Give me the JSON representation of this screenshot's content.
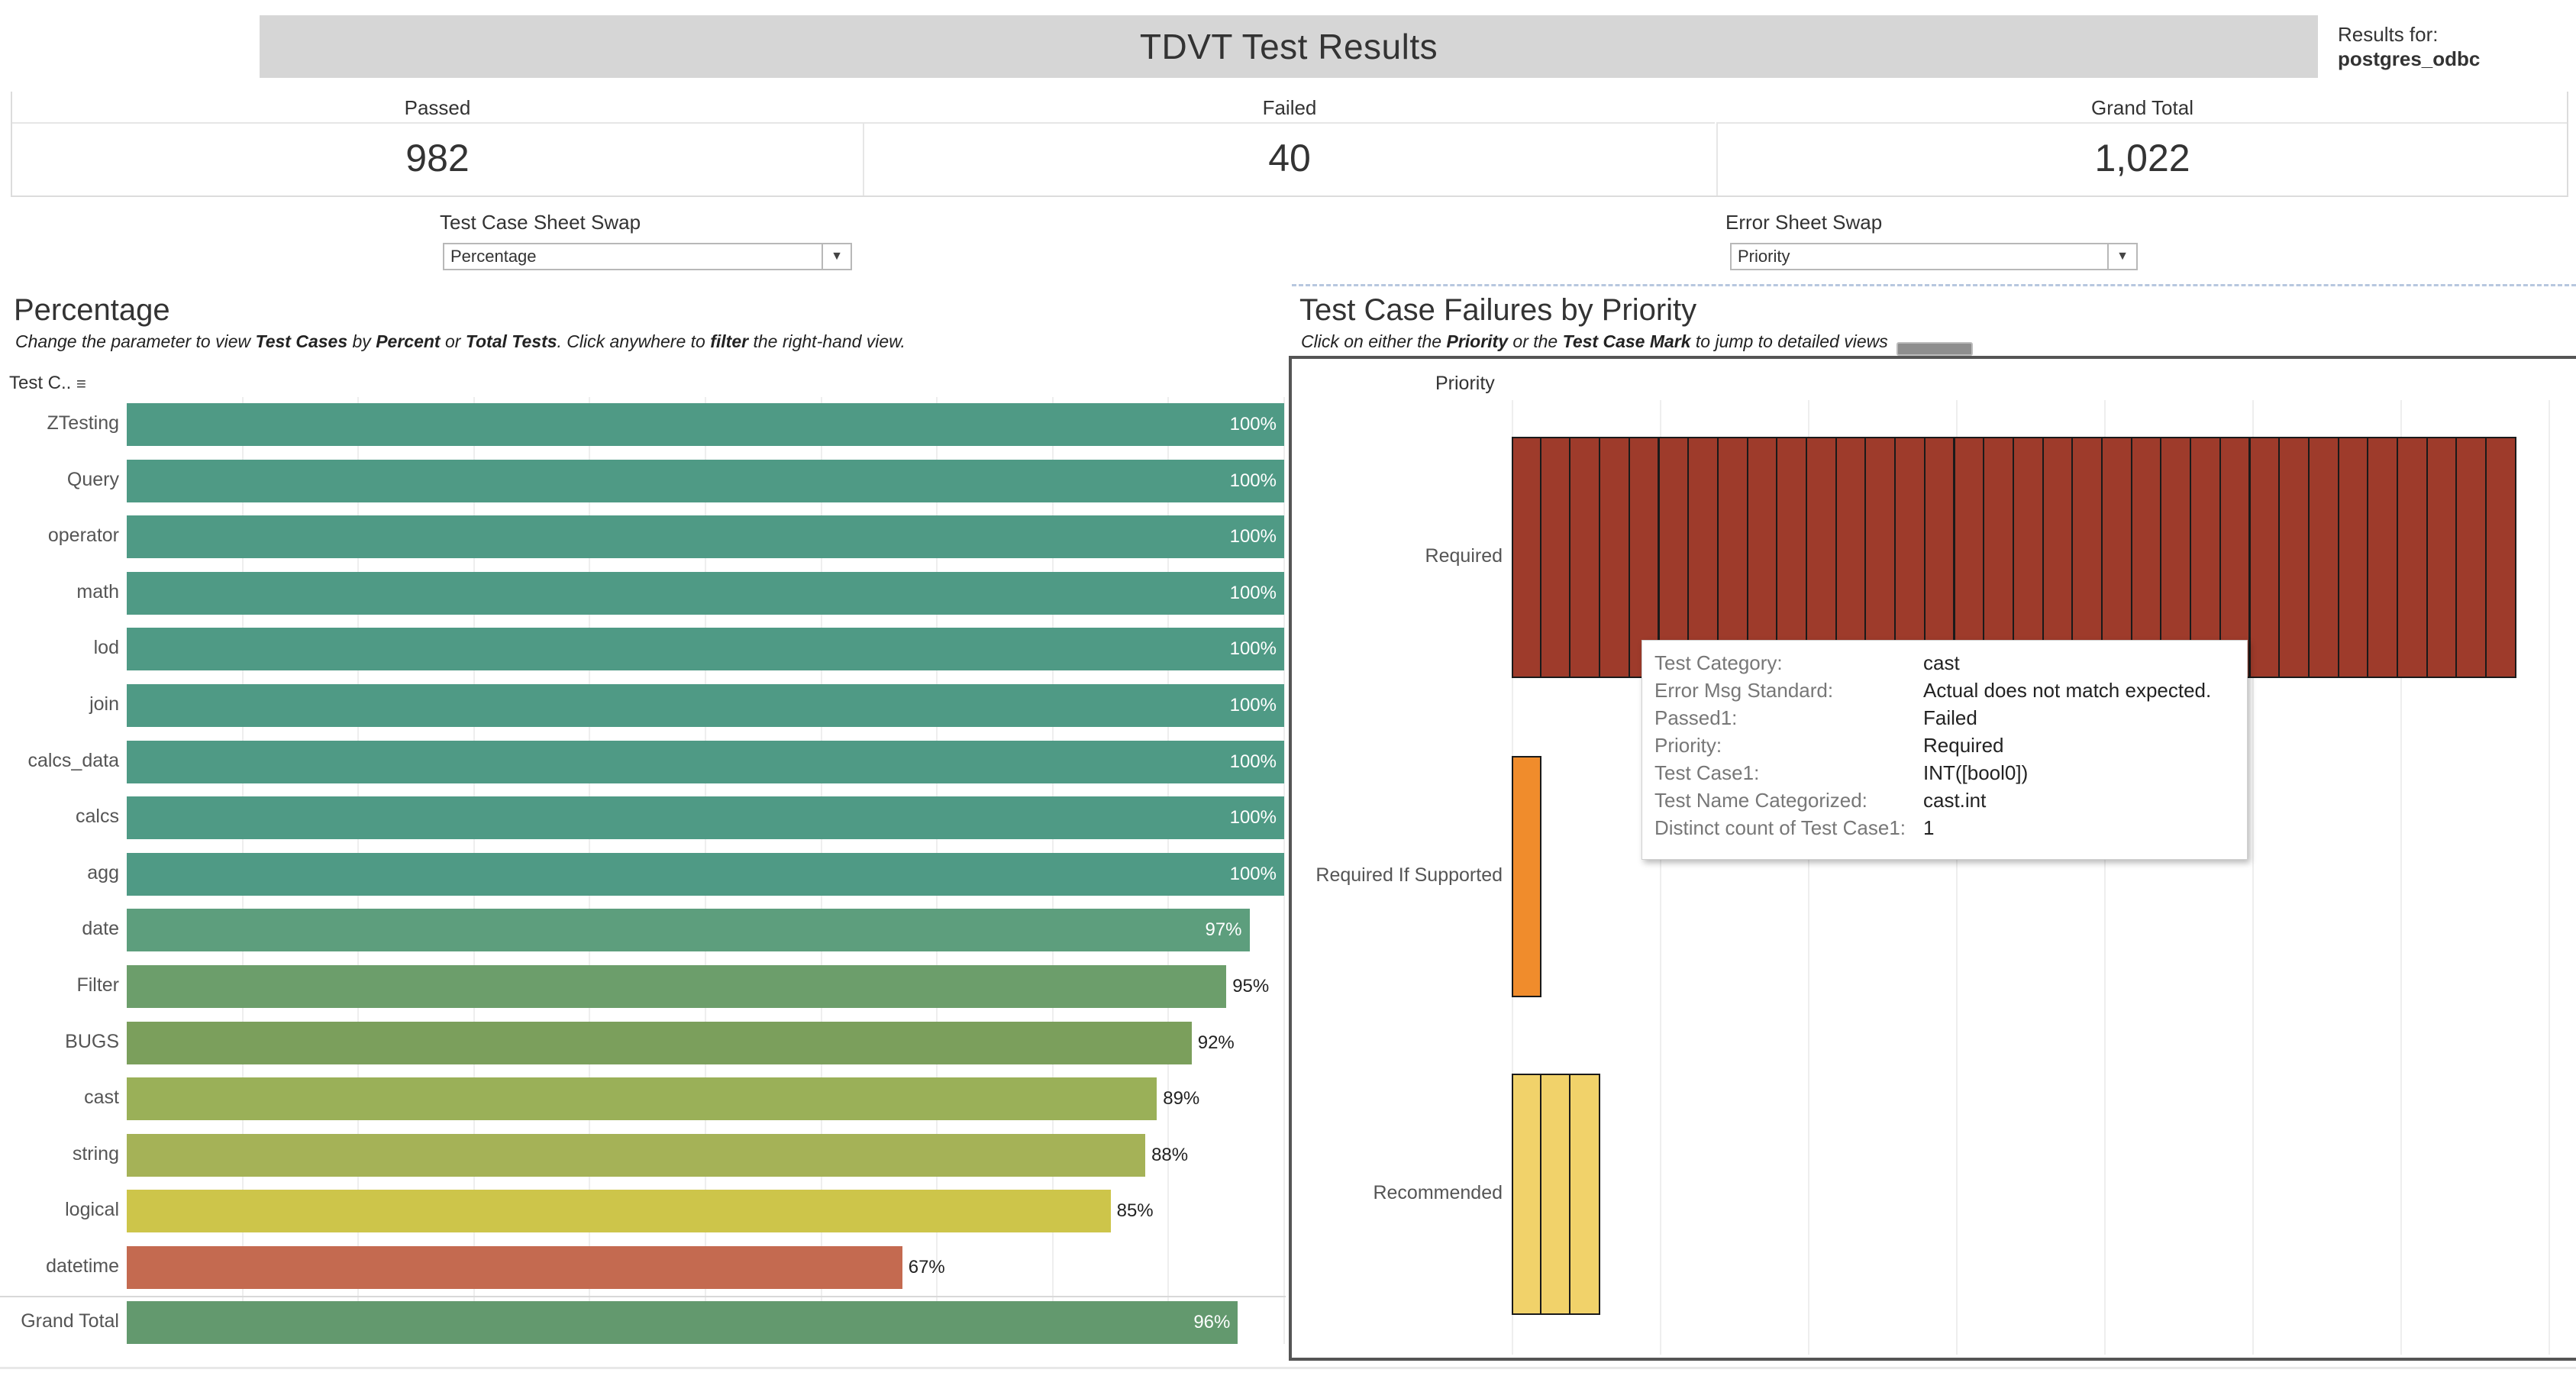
{
  "header": {
    "title": "TDVT Test Results",
    "results_for_label": "Results for:",
    "results_for_value": "postgres_odbc"
  },
  "summary": {
    "passed_label": "Passed",
    "passed_value": "982",
    "failed_label": "Failed",
    "failed_value": "40",
    "total_label": "Grand Total",
    "total_value": "1,022"
  },
  "params": {
    "test_case_label": "Test Case Sheet Swap",
    "test_case_value": "Percentage",
    "error_label": "Error Sheet Swap",
    "error_value": "Priority"
  },
  "left": {
    "title": "Percentage",
    "subtitle_html": "Change the parameter to view <b>Test Cases</b> by <b>Percent</b> or <b>Total Tests</b>. Click anywhere to <b>filter</b> the right-hand view.",
    "axis_header": "Test C..",
    "sort_icon": "sort-descending-icon"
  },
  "chart_data": [
    {
      "type": "bar",
      "orientation": "horizontal",
      "categories": [
        "ZTesting",
        "Query",
        "operator",
        "math",
        "lod",
        "join",
        "calcs_data",
        "calcs",
        "agg",
        "date",
        "Filter",
        "BUGS",
        "cast",
        "string",
        "logical",
        "datetime",
        "Grand Total"
      ],
      "values": [
        100,
        100,
        100,
        100,
        100,
        100,
        100,
        100,
        100,
        97,
        95,
        92,
        89,
        88,
        85,
        67,
        96
      ],
      "labels": [
        "100%",
        "100%",
        "100%",
        "100%",
        "100%",
        "100%",
        "100%",
        "100%",
        "100%",
        "97%",
        "95%",
        "92%",
        "89%",
        "88%",
        "85%",
        "67%",
        "96%"
      ],
      "colors": [
        "#4f9a85",
        "#4f9a85",
        "#4f9a85",
        "#4f9a85",
        "#4f9a85",
        "#4f9a85",
        "#4f9a85",
        "#4f9a85",
        "#4f9a85",
        "#5d9e7d",
        "#6c9e6b",
        "#7b9f5c",
        "#9ab058",
        "#a5b257",
        "#cdc54a",
        "#c46a50",
        "#63996e"
      ],
      "xlim": [
        0,
        100
      ]
    },
    {
      "type": "bar",
      "title": "Test Case Failures by Priority",
      "subtitle_html": "Click on either the <b>Priority</b> or the <b>Test Case Mark</b> to jump to detailed views",
      "header": "Priority",
      "categories": [
        "Required",
        "Required If Supported",
        "Recommended"
      ],
      "values": [
        34,
        1,
        3
      ],
      "colors": [
        "#9e3b2b",
        "#f08c2c",
        "#f1d26a"
      ]
    }
  ],
  "tooltip": {
    "rows": [
      {
        "key": "Test Category:",
        "value": "cast"
      },
      {
        "key": "Error Msg Standard:",
        "value": "Actual does not match expected."
      },
      {
        "key": "Passed1:",
        "value": "Failed"
      },
      {
        "key": "Priority:",
        "value": "Required"
      },
      {
        "key": "Test Case1:",
        "value": "INT([bool0])"
      },
      {
        "key": "Test Name Categorized:",
        "value": "cast.int"
      },
      {
        "key": "Distinct count of Test Case1:",
        "value": "1"
      }
    ]
  }
}
